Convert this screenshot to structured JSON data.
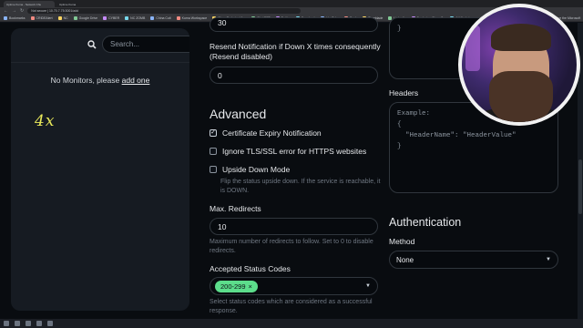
{
  "browser": {
    "tabs": [
      "Uptime Kuma - Network Chu",
      "Uptime Kuma"
    ],
    "url": "Not secure | 10.70.7.75:3001/add",
    "bookmarks": [
      "Bookmarks",
      "CRIDEAlert",
      "NC",
      "Google Drive",
      "CYBER",
      "NC ZOMB",
      "China Cult",
      "Kuma Workspace",
      "Cisco Technical Ass",
      "ChatGPT",
      "Twitter",
      "Facebook",
      "YouTube",
      "Bank",
      "Timeblade",
      "LinkedIn",
      "Deploying Cisco Ca",
      "AI Workstream",
      "Dashcraft",
      "Free Ice Coffee Fo",
      "Improve the Microsoft"
    ]
  },
  "sidebar": {
    "search_placeholder": "Search...",
    "empty_text": "No Monitors, please",
    "add_link": "add one",
    "annotation": "4x"
  },
  "form": {
    "timeout_value": "30",
    "resend_label": "Resend Notification if Down X times consequently (Resend disabled)",
    "resend_value": "0",
    "advanced_title": "Advanced",
    "cert_expiry_label": "Certificate Expiry Notification",
    "cert_expiry_checked": true,
    "ignore_tls_label": "Ignore TLS/SSL error for HTTPS websites",
    "upside_down_label": "Upside Down Mode",
    "upside_down_hint": "Flip the status upside down. If the service is reachable, it is DOWN.",
    "max_redirects_label": "Max. Redirects",
    "max_redirects_value": "10",
    "max_redirects_hint": "Maximum number of redirects to follow. Set to 0 to disable redirects.",
    "accepted_codes_label": "Accepted Status Codes",
    "accepted_code_chip": "200-299",
    "accepted_codes_hint": "Select status codes which are considered as a successful response."
  },
  "right": {
    "body_closing": "}",
    "headers_label": "Headers",
    "headers_placeholder": "Example:\n{\n  \"HeaderName\": \"HeaderValue\"\n}",
    "auth_title": "Authentication",
    "method_label": "Method",
    "method_value": "None"
  },
  "colors": {
    "background": "#090c10",
    "panel": "#161b22",
    "accent_green": "#5cdd8b",
    "annotation_yellow": "#e8e85a"
  }
}
